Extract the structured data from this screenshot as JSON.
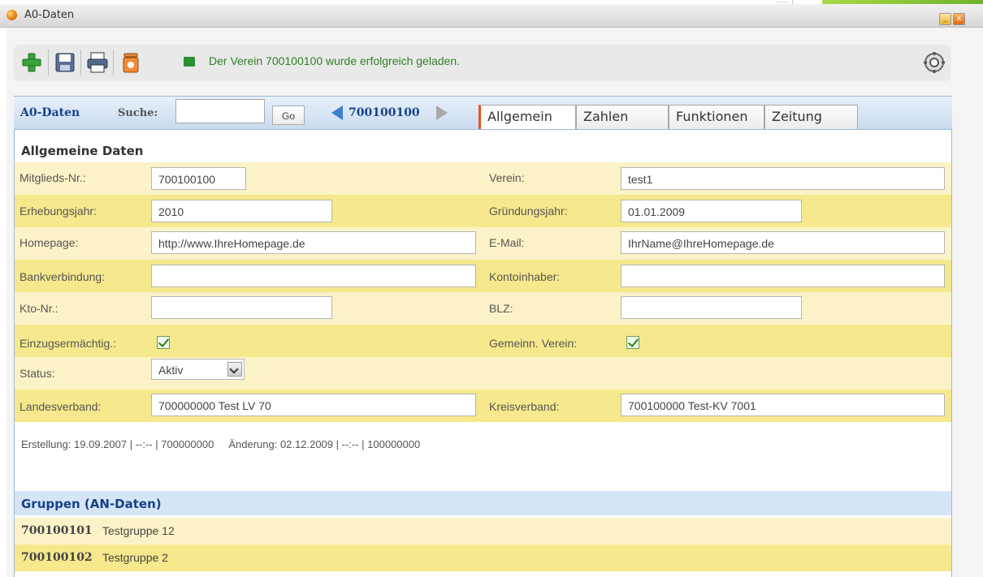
{
  "window": {
    "title": "A0-Daten",
    "minimize_label": "_",
    "close_label": "x"
  },
  "toolbar": {
    "buttons": [
      "add-icon",
      "save-icon",
      "print-icon",
      "delete-icon",
      "settings-icon"
    ],
    "status_message": "Der Verein 700100100 wurde erfolgreich geladen."
  },
  "header": {
    "title": "A0-Daten",
    "search_label": "Suche:",
    "search_value": "",
    "go_label": "Go",
    "record_number": "700100100",
    "tabs": [
      {
        "label": "Allgemein",
        "active": true
      },
      {
        "label": "Zahlen",
        "active": false
      },
      {
        "label": "Funktionen",
        "active": false
      },
      {
        "label": "Zeitung",
        "active": false
      }
    ]
  },
  "form": {
    "section_title": "Allgemeine Daten",
    "mitglieds_nr": {
      "label": "Mitglieds-Nr.:",
      "value": "700100100"
    },
    "verein": {
      "label": "Verein:",
      "value": "test1"
    },
    "erhebungsjahr": {
      "label": "Erhebungsjahr:",
      "value": "2010"
    },
    "gruendungsjahr": {
      "label": "Gründungsjahr:",
      "value": "01.01.2009"
    },
    "homepage": {
      "label": "Homepage:",
      "value": "http://www.IhreHomepage.de"
    },
    "email": {
      "label": "E-Mail:",
      "value": "IhrName@IhreHomepage.de"
    },
    "bankverbindung": {
      "label": "Bankverbindung:",
      "value": ""
    },
    "kontoinhaber": {
      "label": "Kontoinhaber:",
      "value": ""
    },
    "kto_nr": {
      "label": "Kto-Nr.:",
      "value": ""
    },
    "blz": {
      "label": "BLZ:",
      "value": ""
    },
    "einzug": {
      "label": "Einzugsermächtig.:",
      "checked": true
    },
    "gemeinn": {
      "label": "Gemeinn. Verein:",
      "checked": true
    },
    "status": {
      "label": "Status:",
      "value": "Aktiv"
    },
    "landesverband": {
      "label": "Landesverband:",
      "value": "700000000  Test LV 70"
    },
    "kreisverband": {
      "label": "Kreisverband:",
      "value": "700100000  Test-KV 7001"
    }
  },
  "meta_line": "Erstellung: 19.09.2007 | --:-- | 700000000     Änderung: 02.12.2009 | --:-- | 100000000",
  "groups": {
    "title": "Gruppen (AN-Daten)",
    "items": [
      {
        "number": "700100101",
        "name": "Testgruppe 12"
      },
      {
        "number": "700100102",
        "name": "Testgruppe 2"
      }
    ]
  },
  "colors": {
    "row_light": "#fbf3c7",
    "row_dark": "#f6e88c",
    "header_blue": "#15418a",
    "status_green": "#2f7f25",
    "active_tab_accent": "#e2571c"
  }
}
